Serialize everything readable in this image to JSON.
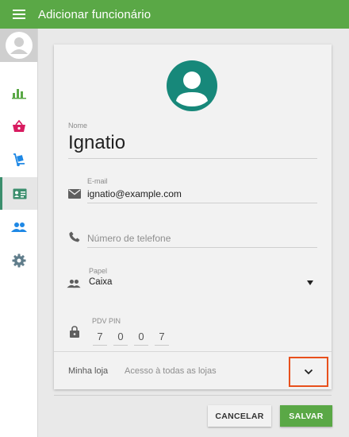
{
  "header": {
    "title": "Adicionar funcionário"
  },
  "colors": {
    "brand": "#5aa846",
    "accent": "#3b8e6d",
    "highlight": "#e8501c",
    "avatar": "#17887a"
  },
  "sidebar": {
    "items": [
      {
        "name": "reports",
        "icon": "bar-chart-icon"
      },
      {
        "name": "items",
        "icon": "basket-icon"
      },
      {
        "name": "inventory",
        "icon": "dolly-icon"
      },
      {
        "name": "employees",
        "icon": "id-card-icon",
        "active": true
      },
      {
        "name": "customers",
        "icon": "people-icon"
      },
      {
        "name": "settings",
        "icon": "gear-icon"
      }
    ]
  },
  "form": {
    "name": {
      "label": "Nome",
      "value": "Ignatio"
    },
    "email": {
      "label": "E-mail",
      "value": "ignatio@example.com"
    },
    "phone": {
      "placeholder": "Número de telefone"
    },
    "role": {
      "label": "Papel",
      "value": "Caixa"
    },
    "pin": {
      "label": "PDV PIN",
      "digits": [
        "7",
        "0",
        "0",
        "7"
      ]
    },
    "store": {
      "label": "Minha loja",
      "value": "Acesso à todas as lojas"
    }
  },
  "actions": {
    "cancel": "CANCELAR",
    "save": "SALVAR"
  }
}
